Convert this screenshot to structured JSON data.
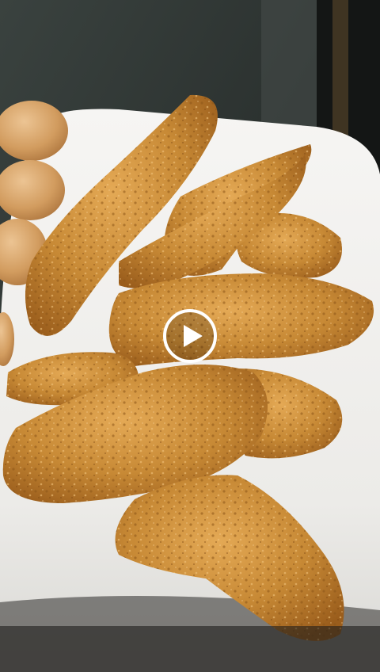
{
  "player": {
    "state": "paused",
    "controls": [
      "play-icon"
    ]
  },
  "colors": {
    "counter_dark": "#2c3331",
    "plate": "#f4f2ef",
    "breading": "#c98a3a",
    "breading_dark": "#8c5518",
    "roll": "#d8a46a",
    "play_overlay": "#ffffff"
  }
}
